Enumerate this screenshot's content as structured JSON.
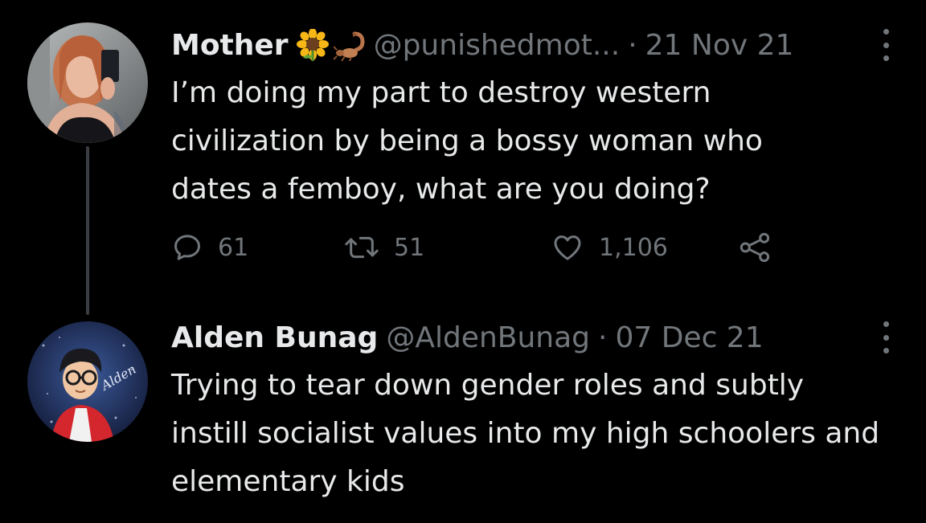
{
  "tweets": [
    {
      "display_name": "Mother",
      "emojis": [
        "sunflower-emoji",
        "scorpion-emoji"
      ],
      "handle": "@punishedmot...",
      "separator": "·",
      "date": "21 Nov 21",
      "text": "I’m doing my part to destroy western civilization by being a bossy woman who dates a femboy, what are you doing?",
      "actions": {
        "replies": "61",
        "retweets": "51",
        "likes": "1,106"
      }
    },
    {
      "display_name": "Alden Bunag",
      "handle": "@AldenBunag",
      "separator": "·",
      "date": "07 Dec 21",
      "text": "Trying to tear down gender roles and subtly instill socialist values into my high schoolers and elementary kids"
    }
  ],
  "icons": {
    "reply": "reply-icon",
    "retweet": "retweet-icon",
    "like": "heart-icon",
    "share": "share-icon",
    "more": "more-options-icon"
  },
  "colors": {
    "background": "#000000",
    "primary_text": "#e7e9ea",
    "secondary_text": "#71767b",
    "thread_line": "#3a3d41"
  }
}
